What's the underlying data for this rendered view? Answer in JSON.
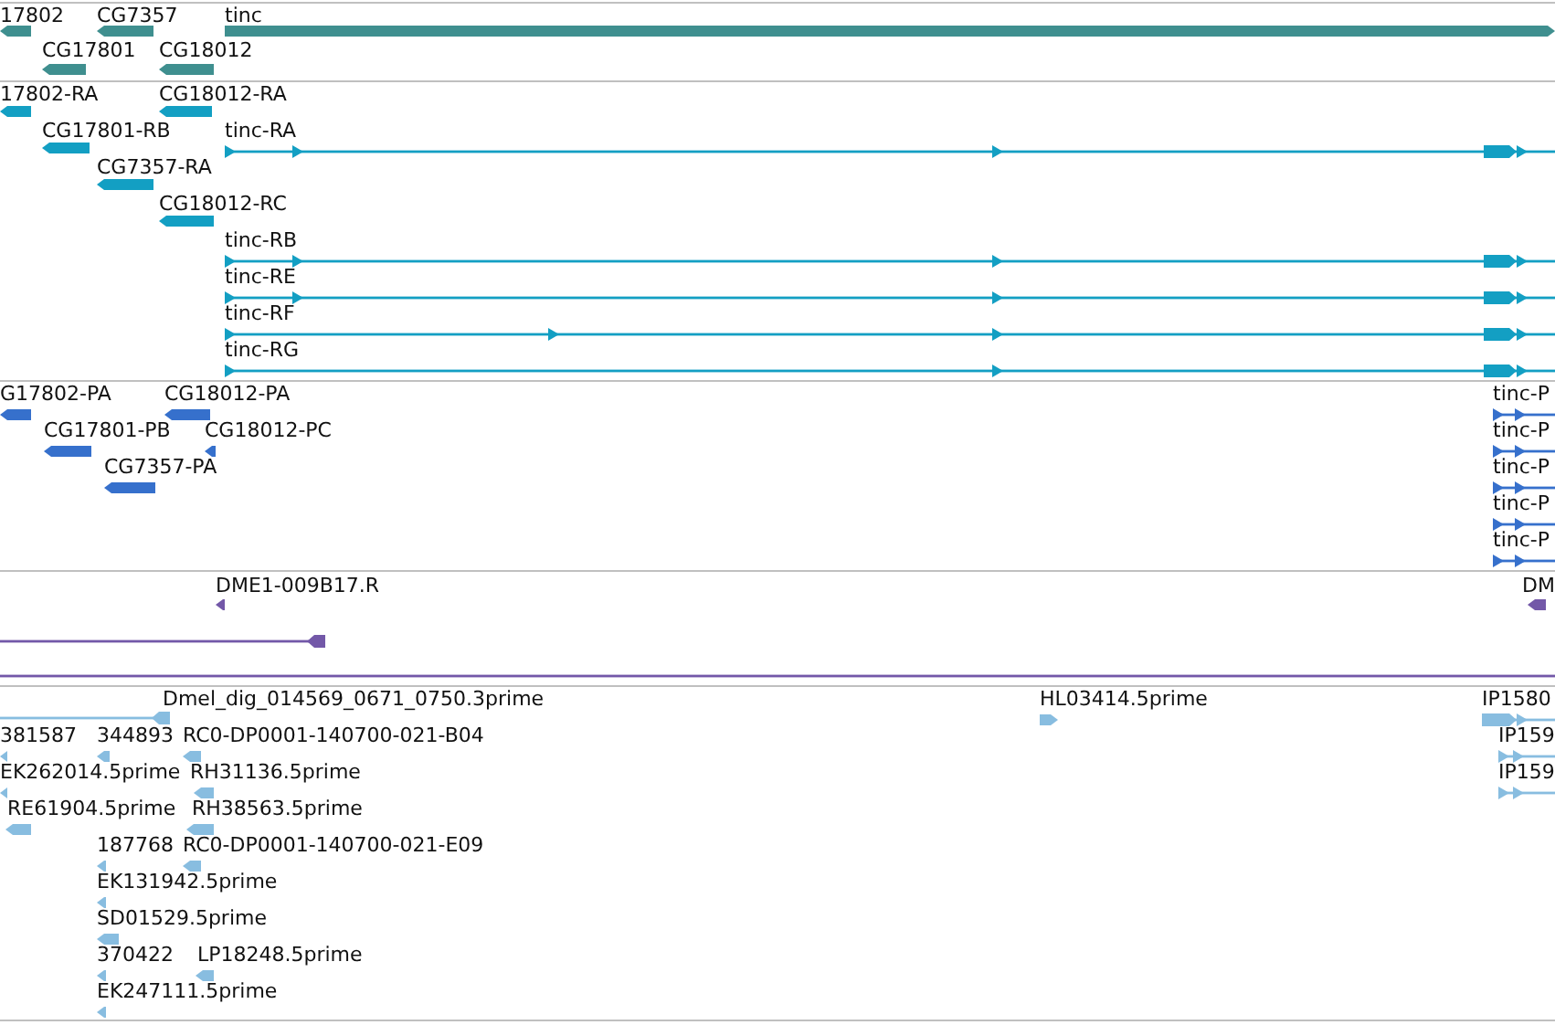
{
  "tracks": [
    {
      "color": "#3f8f8f",
      "features": [
        {
          "label": "17802",
          "kind": "block",
          "reverse": true
        },
        {
          "label": "CG7357",
          "kind": "block",
          "reverse": true
        },
        {
          "label": "tinc",
          "kind": "block",
          "reverse": false
        },
        {
          "label": "CG17801",
          "kind": "block",
          "reverse": true
        },
        {
          "label": "CG18012",
          "kind": "block",
          "reverse": true
        }
      ]
    },
    {
      "color": "#139fc3",
      "features": [
        {
          "label": "17802-RA",
          "kind": "block",
          "reverse": true
        },
        {
          "label": "CG18012-RA",
          "kind": "block",
          "reverse": true
        },
        {
          "label": "CG17801-RB",
          "kind": "block",
          "reverse": true
        },
        {
          "label": "tinc-RA",
          "kind": "spliced",
          "reverse": false
        },
        {
          "label": "CG7357-RA",
          "kind": "block",
          "reverse": true
        },
        {
          "label": "CG18012-RC",
          "kind": "block",
          "reverse": true
        },
        {
          "label": "tinc-RB",
          "kind": "spliced",
          "reverse": false
        },
        {
          "label": "tinc-RE",
          "kind": "spliced",
          "reverse": false
        },
        {
          "label": "tinc-RF",
          "kind": "spliced",
          "reverse": false
        },
        {
          "label": "tinc-RG",
          "kind": "spliced",
          "reverse": false
        }
      ]
    },
    {
      "color": "#3670cc",
      "features": [
        {
          "label": "G17802-PA",
          "kind": "block",
          "reverse": true
        },
        {
          "label": "CG18012-PA",
          "kind": "block",
          "reverse": true
        },
        {
          "label": "CG17801-PB",
          "kind": "block",
          "reverse": true
        },
        {
          "label": "CG18012-PC",
          "kind": "block",
          "reverse": true
        },
        {
          "label": "CG7357-PA",
          "kind": "block",
          "reverse": true
        },
        {
          "label": "tinc-P",
          "kind": "spliced",
          "reverse": false
        },
        {
          "label": "tinc-P",
          "kind": "spliced",
          "reverse": false
        },
        {
          "label": "tinc-P",
          "kind": "spliced",
          "reverse": false
        },
        {
          "label": "tinc-P",
          "kind": "spliced",
          "reverse": false
        },
        {
          "label": "tinc-P",
          "kind": "spliced",
          "reverse": false
        }
      ]
    },
    {
      "color": "#7358a8",
      "features": [
        {
          "label": "DME1-009B17.R",
          "kind": "block",
          "reverse": true
        },
        {
          "label": "DM",
          "kind": "block",
          "reverse": true
        },
        {
          "kind": "spliced",
          "reverse": true
        },
        {
          "kind": "spliced"
        }
      ]
    },
    {
      "color": "#88bde0",
      "features": [
        {
          "label": "Dmel_dig_014569_0671_0750.3prime",
          "kind": "spliced",
          "reverse": true
        },
        {
          "label": "HL03414.5prime",
          "kind": "block",
          "reverse": false
        },
        {
          "label": "IP1580",
          "kind": "spliced",
          "reverse": false
        },
        {
          "label": "381587",
          "kind": "block",
          "reverse": true
        },
        {
          "label": "344893",
          "kind": "block",
          "reverse": true
        },
        {
          "label": "RC0-DP0001-140700-021-B04",
          "kind": "block",
          "reverse": true
        },
        {
          "label": "IP159",
          "kind": "spliced",
          "reverse": false
        },
        {
          "label": "EK262014.5prime",
          "kind": "block",
          "reverse": true
        },
        {
          "label": "RH31136.5prime",
          "kind": "block",
          "reverse": true
        },
        {
          "label": "IP159",
          "kind": "spliced",
          "reverse": false
        },
        {
          "label": "RE61904.5prime",
          "kind": "block",
          "reverse": true
        },
        {
          "label": "RH38563.5prime",
          "kind": "block",
          "reverse": true
        },
        {
          "label": "187768",
          "kind": "block",
          "reverse": true
        },
        {
          "label": "RC0-DP0001-140700-021-E09",
          "kind": "block",
          "reverse": true
        },
        {
          "label": "EK131942.5prime",
          "kind": "block",
          "reverse": true
        },
        {
          "label": "SD01529.5prime",
          "kind": "block",
          "reverse": true
        },
        {
          "label": "370422",
          "kind": "block",
          "reverse": true
        },
        {
          "label": "LP18248.5prime",
          "kind": "block",
          "reverse": true
        },
        {
          "label": "EK247111.5prime",
          "kind": "block",
          "reverse": true
        }
      ]
    }
  ]
}
